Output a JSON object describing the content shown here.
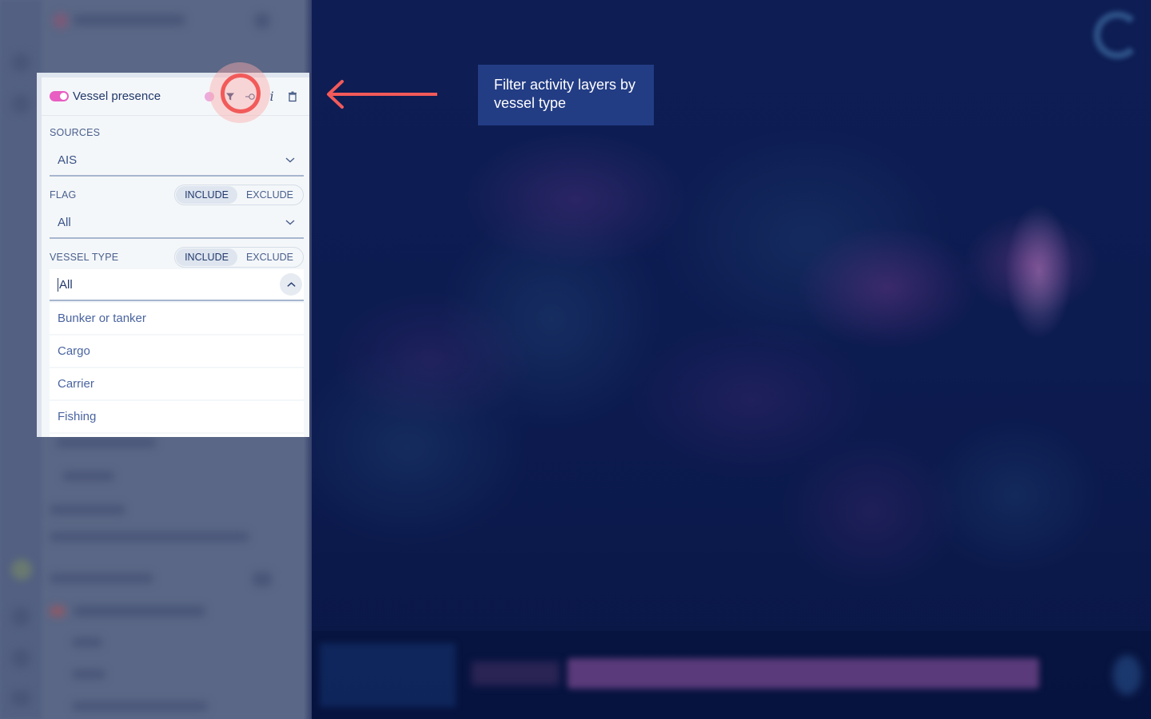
{
  "layer_panel": {
    "title": "Vessel presence",
    "toggle_on": true,
    "accent_color": "#e85ec2",
    "header_icons": [
      "color-swatch-icon",
      "filter-icon",
      "settings-icon",
      "info-icon",
      "delete-icon"
    ],
    "info_glyph": "i",
    "sources": {
      "label": "SOURCES",
      "value": "AIS"
    },
    "flag": {
      "label": "FLAG",
      "mode_options": [
        "INCLUDE",
        "EXCLUDE"
      ],
      "mode_selected": "INCLUDE",
      "value": "All"
    },
    "vessel_type": {
      "label": "VESSEL TYPE",
      "mode_options": [
        "INCLUDE",
        "EXCLUDE"
      ],
      "mode_selected": "INCLUDE",
      "input_value": "All",
      "expanded": true,
      "options": [
        "Bunker or tanker",
        "Cargo",
        "Carrier",
        "Fishing"
      ]
    }
  },
  "annotation": {
    "tooltip_text": "Filter activity layers by vessel type",
    "highlight_color": "#f25a5a",
    "tooltip_bg": "#233d85"
  }
}
